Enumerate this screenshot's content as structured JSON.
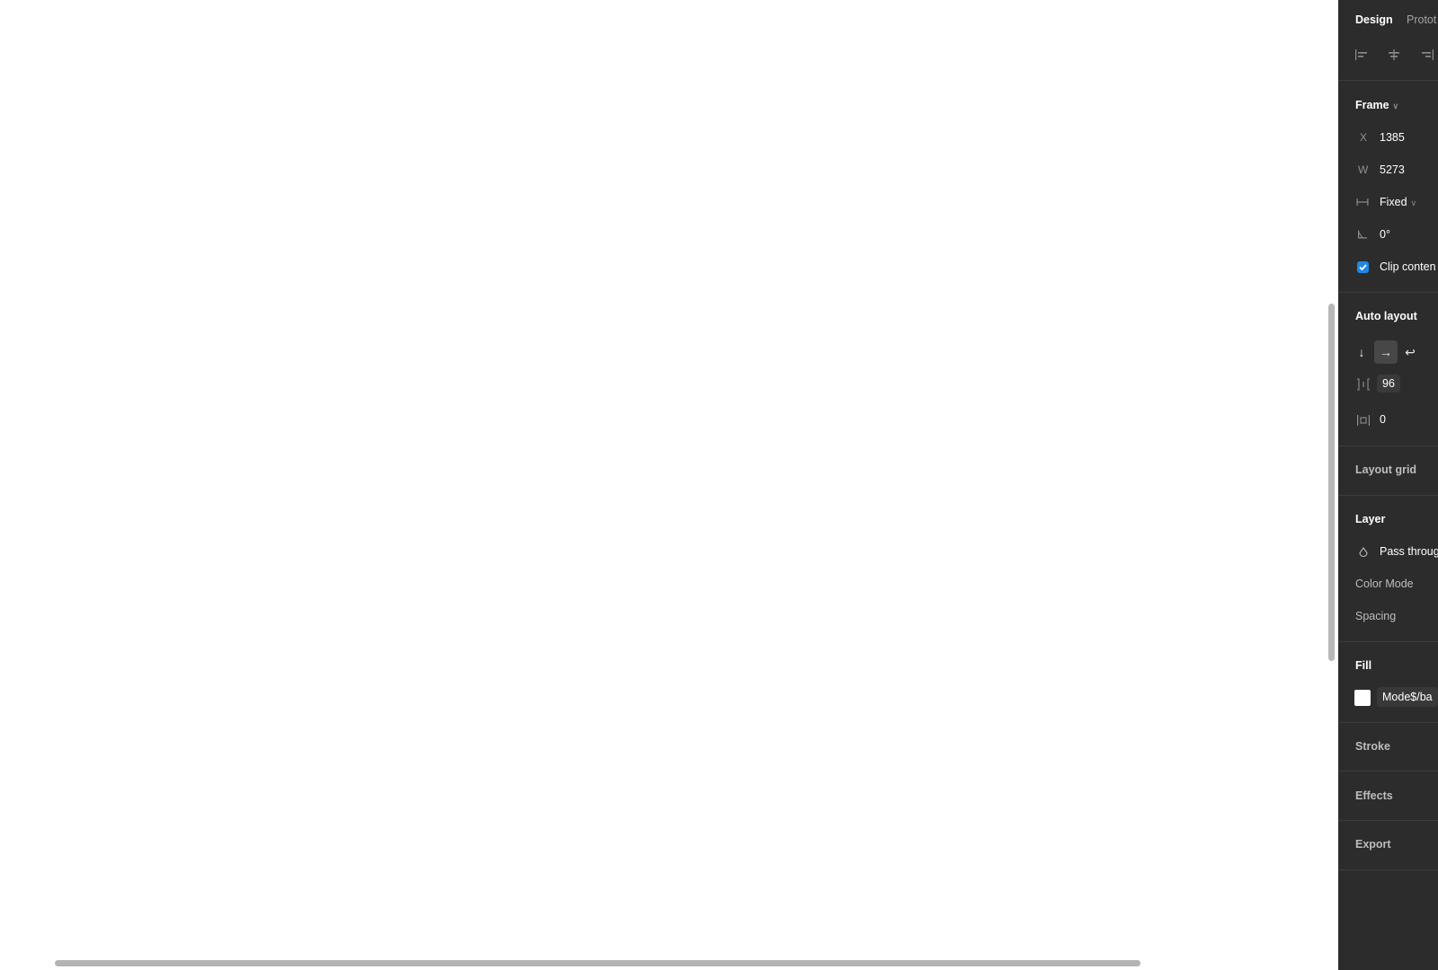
{
  "tabs": {
    "design": "Design",
    "prototype": "Protot"
  },
  "frame": {
    "title": "Frame",
    "x_label": "X",
    "x_value": "1385",
    "w_label": "W",
    "w_value": "5273",
    "sizing": "Fixed",
    "rotation": "0°",
    "clip_content": "Clip conten",
    "clip_checked": true
  },
  "auto_layout": {
    "title": "Auto layout",
    "direction_icons": [
      "arrow-down-icon",
      "arrow-right-icon",
      "wrap-icon"
    ],
    "active_direction": "horizontal",
    "gap": "96",
    "padding": "0"
  },
  "layout_grid": {
    "title": "Layout grid"
  },
  "layer": {
    "title": "Layer",
    "blend_mode": "Pass throug",
    "color_mode": "Color Mode",
    "spacing": "Spacing"
  },
  "fill": {
    "title": "Fill",
    "swatch_color": "#ffffff",
    "variable": "Mode$/ba"
  },
  "stroke": {
    "title": "Stroke"
  },
  "effects": {
    "title": "Effects"
  },
  "export": {
    "title": "Export"
  },
  "colors": {
    "panel_bg": "#2c2c2c",
    "accent": "#1e88e5",
    "canvas_bg": "#ffffff"
  }
}
